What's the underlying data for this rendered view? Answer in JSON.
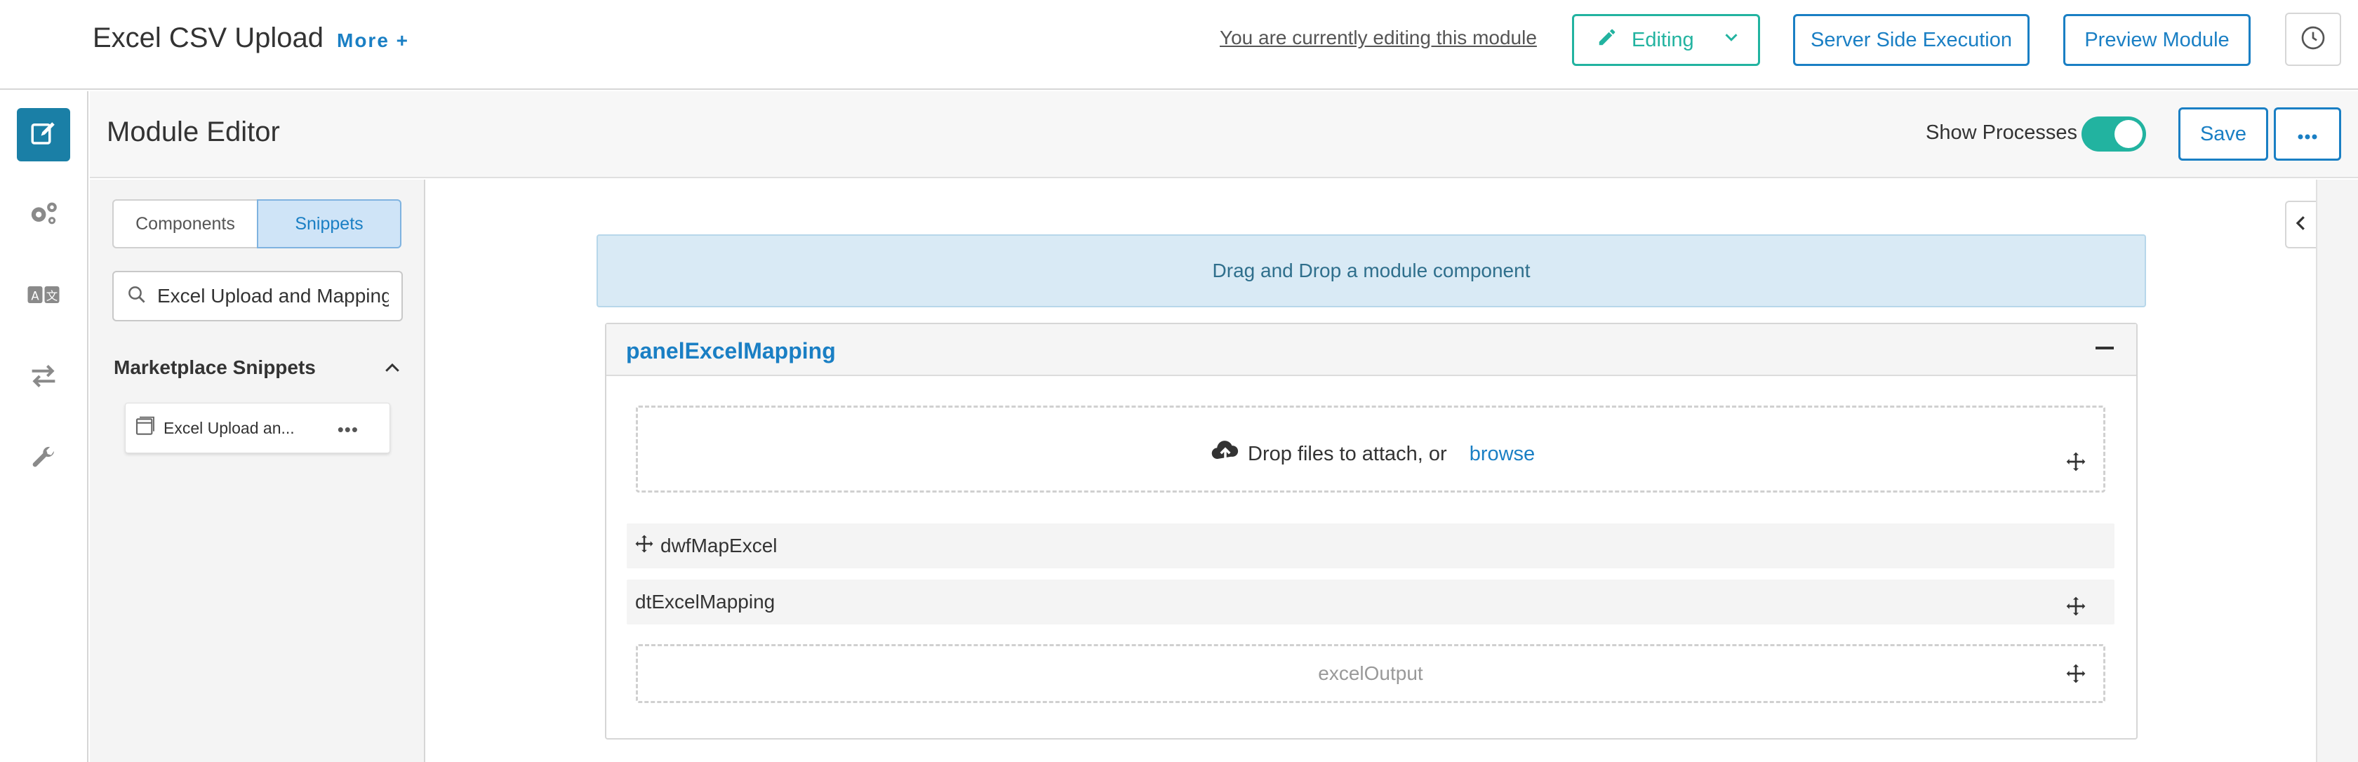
{
  "header": {
    "title": "Excel CSV Upload",
    "more_label": "More +",
    "editing_note": "You are currently editing this module",
    "editing_label": "Editing",
    "server_label": "Server Side Execution",
    "preview_label": "Preview Module"
  },
  "rail": {
    "items": [
      "edit-icon",
      "gears-icon",
      "translate-icon",
      "arrows-icon",
      "wrench-icon"
    ],
    "active_color": "#1a7fa6"
  },
  "editor": {
    "title": "Module Editor",
    "show_processes_label": "Show Processes",
    "save_label": "Save"
  },
  "palette": {
    "tabs": [
      "Components",
      "Snippets"
    ],
    "active_tab": "Snippets",
    "search_value": "Excel Upload and Mapping",
    "section_label": "Marketplace Snippets",
    "snippet_name": "Excel Upload an...",
    "snippet_more": "•••"
  },
  "canvas": {
    "drop_zone_text": "Drag and Drop a module component",
    "panel_title": "panelExcelMapping",
    "attach_text": "Drop files to attach, or",
    "browse_label": "browse",
    "row1_label": "dwfMapExcel",
    "row2_label": "dtExcelMapping",
    "output_label": "excelOutput"
  },
  "colors": {
    "accent": "#1a7fc4",
    "teal": "#22b3a0"
  }
}
